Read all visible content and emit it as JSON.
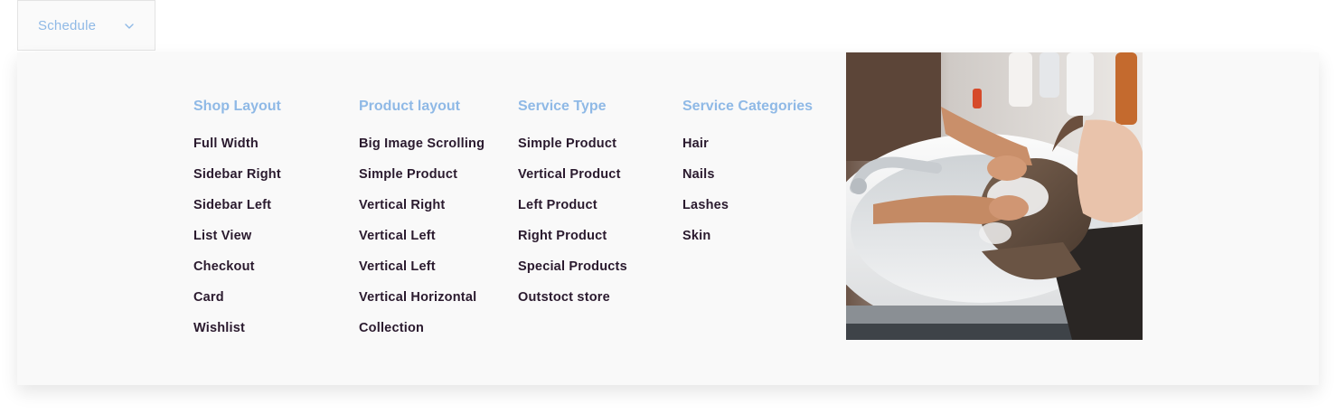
{
  "nav": {
    "label": "Schedule",
    "chevron_icon": "chevron-down-icon"
  },
  "menu": {
    "columns": [
      {
        "title": "Shop Layout",
        "items": [
          "Full Width",
          "Sidebar Right",
          "Sidebar Left",
          "List View",
          "Checkout",
          "Card",
          "Wishlist"
        ]
      },
      {
        "title": "Product layout",
        "items": [
          "Big Image Scrolling",
          "Simple Product",
          "Vertical Right",
          "Vertical Left",
          "Vertical Left",
          "Vertical Horizontal",
          "Collection"
        ]
      },
      {
        "title": "Service Type",
        "items": [
          "Simple Product",
          "Vertical Product",
          "Left Product",
          "Right Product",
          "Special Products",
          "Outstoct store"
        ]
      },
      {
        "title": "Service Categories",
        "items": [
          "Hair",
          "Nails",
          "Lashes",
          "Skin"
        ]
      }
    ]
  },
  "colors": {
    "accent": "#8fb9e6",
    "text": "#2a1a2e",
    "panel": "#f9f9f9"
  }
}
